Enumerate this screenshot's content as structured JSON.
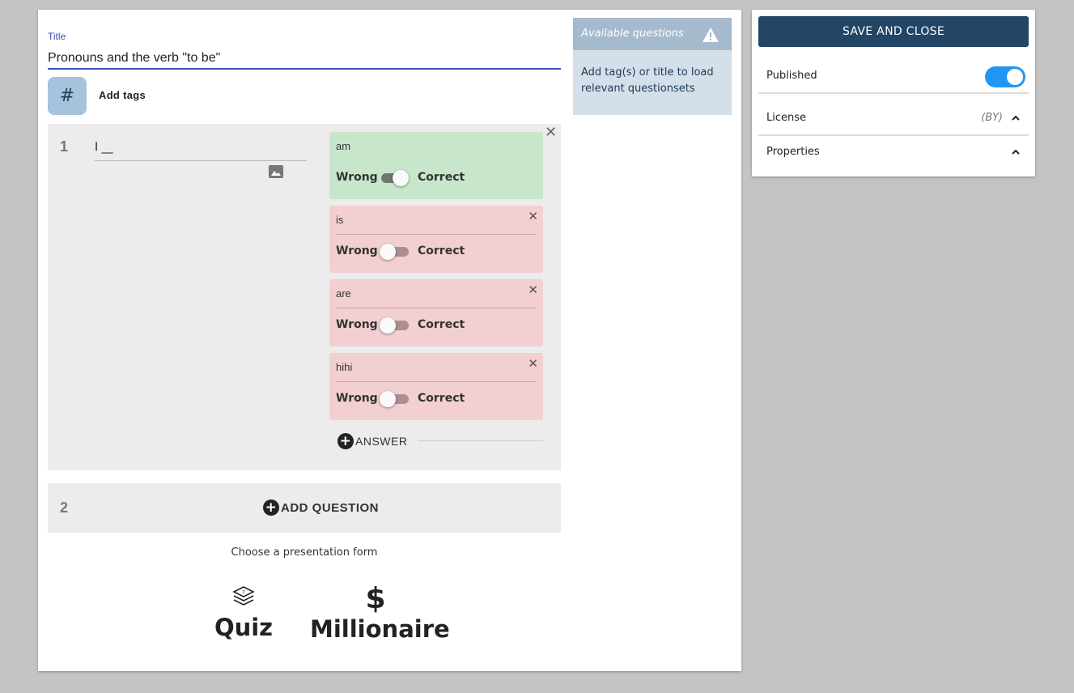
{
  "editor": {
    "title_label": "Title",
    "title_value": "Pronouns and the verb \"to be\"",
    "tag_button_symbol": "#",
    "add_tags_label": "Add tags",
    "questions": [
      {
        "number": "1",
        "text": "I __",
        "answers": [
          {
            "text": "am",
            "correct": true
          },
          {
            "text": "is",
            "correct": false
          },
          {
            "text": "are",
            "correct": false
          },
          {
            "text": "hihi",
            "correct": false
          }
        ],
        "wrong_label": "Wrong",
        "correct_label": "Correct",
        "add_answer_label": "ANSWER"
      }
    ],
    "next_question_number": "2",
    "add_question_label": "ADD QUESTION",
    "choose_form_label": "Choose a presentation form",
    "forms": {
      "quiz_label": "Quiz",
      "millionaire_label": "Millionaire",
      "millionaire_symbol": "$"
    }
  },
  "available": {
    "title": "Available questions",
    "body": "Add tag(s) or title to load relevant questionsets"
  },
  "sidebar": {
    "save_label": "SAVE AND CLOSE",
    "published_label": "Published",
    "published": true,
    "license_label": "License",
    "license_value": "(BY)",
    "properties_label": "Properties"
  },
  "colors": {
    "primary": "#234566",
    "accent": "#3f51b5",
    "toggle_on": "#2196f3",
    "correct_bg": "#c8e6c9",
    "wrong_bg": "#f2cfd0"
  }
}
